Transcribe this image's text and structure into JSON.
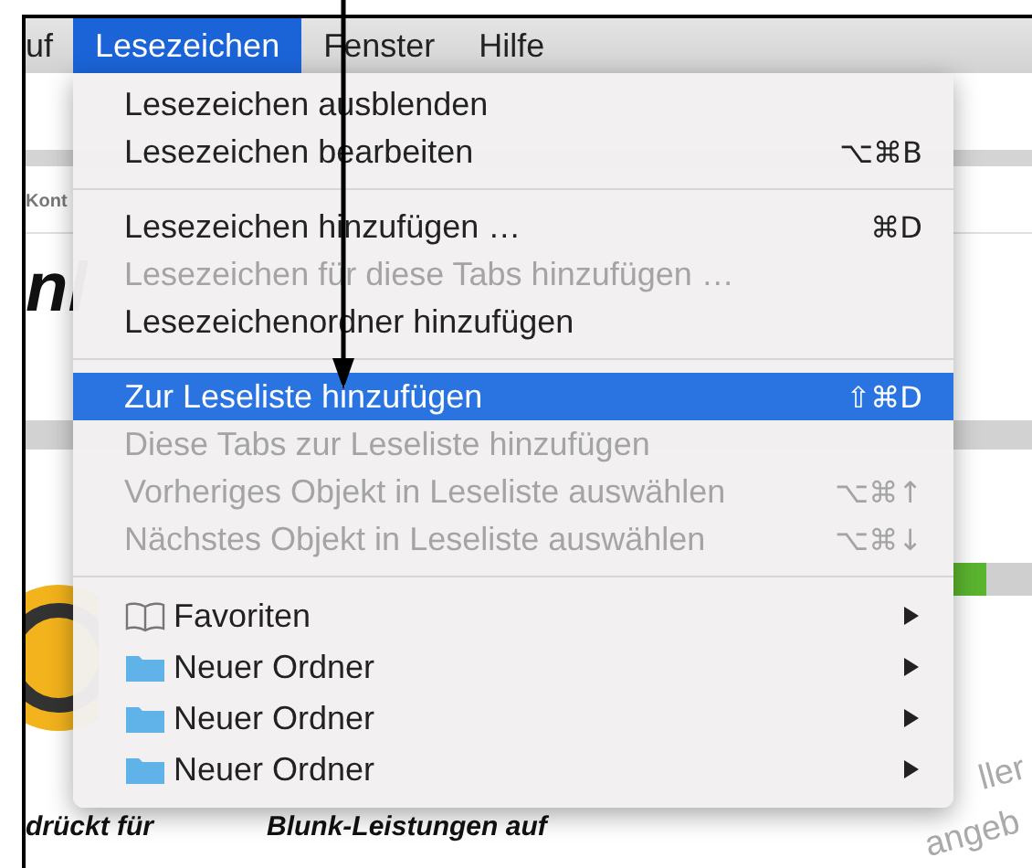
{
  "menubar": {
    "items": [
      {
        "label": "uf",
        "selected": false
      },
      {
        "label": "Lesezeichen",
        "selected": true
      },
      {
        "label": "Fenster",
        "selected": false
      },
      {
        "label": "Hilfe",
        "selected": false
      }
    ]
  },
  "menu": {
    "sections": [
      [
        {
          "kind": "plain",
          "label": "Lesezeichen ausblenden",
          "disabled": false,
          "selected": false
        },
        {
          "kind": "plain",
          "label": "Lesezeichen bearbeiten",
          "shortcut": "⌥⌘B",
          "disabled": false,
          "selected": false
        }
      ],
      [
        {
          "kind": "plain",
          "label": "Lesezeichen hinzufügen …",
          "shortcut": "⌘D",
          "disabled": false,
          "selected": false
        },
        {
          "kind": "plain",
          "label": "Lesezeichen für diese Tabs hinzufügen …",
          "disabled": true,
          "selected": false
        },
        {
          "kind": "plain",
          "label": "Lesezeichenordner hinzufügen",
          "disabled": false,
          "selected": false
        }
      ],
      [
        {
          "kind": "plain",
          "label": "Zur Leseliste hinzufügen",
          "shortcut": "⇧⌘D",
          "disabled": false,
          "selected": true
        },
        {
          "kind": "plain",
          "label": "Diese Tabs zur Leseliste hinzufügen",
          "disabled": true,
          "selected": false
        },
        {
          "kind": "plain",
          "label": "Vorheriges Objekt in Leseliste auswählen",
          "shortcut": "⌥⌘↑",
          "disabled": true,
          "selected": false
        },
        {
          "kind": "plain",
          "label": "Nächstes Objekt in Leseliste auswählen",
          "shortcut": "⌥⌘↓",
          "disabled": true,
          "selected": false
        }
      ],
      [
        {
          "kind": "bookmarks",
          "label": "Favoriten",
          "disabled": false,
          "selected": false
        },
        {
          "kind": "folder",
          "label": "Neuer Ordner",
          "disabled": false,
          "selected": false
        },
        {
          "kind": "folder",
          "label": "Neuer Ordner",
          "disabled": false,
          "selected": false
        },
        {
          "kind": "folder",
          "label": "Neuer Ordner",
          "disabled": false,
          "selected": false
        }
      ]
    ]
  },
  "page": {
    "sidebar_text": "Kont",
    "heading_fragment": "nl",
    "caption_left": "drückt für",
    "caption_right": "Blunk-Leistungen auf",
    "rotated_text": [
      "ller",
      "angeb"
    ]
  }
}
